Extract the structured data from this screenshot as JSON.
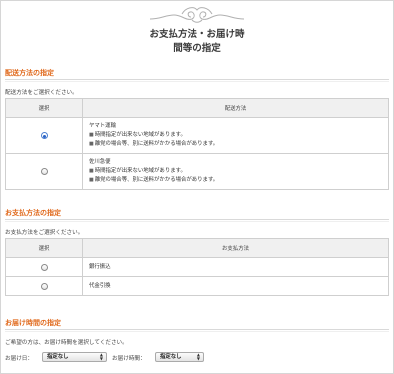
{
  "header": {
    "title_line1": "お支払方法・お届け時",
    "title_line2": "間等の指定"
  },
  "shipping": {
    "section_title": "配送方法の指定",
    "instruction": "配送方法をご選択ください。",
    "col_select": "選択",
    "col_method": "配送方法",
    "options": [
      {
        "name": "ヤマト運輸",
        "checked": true,
        "notes": [
          "時間指定が出来ない地域があります。",
          "離党の場合等、別に送料がかかる場合があります。"
        ]
      },
      {
        "name": "佐川急便",
        "checked": false,
        "notes": [
          "時間指定が出来ない地域があります。",
          "離党の場合等、別に送料がかかる場合があります。"
        ]
      }
    ]
  },
  "payment": {
    "section_title": "お支払方法の指定",
    "instruction": "お支払方法をご選択ください。",
    "col_select": "選択",
    "col_method": "お支払方法",
    "options": [
      {
        "name": "銀行振込",
        "checked": false
      },
      {
        "name": "代金引換",
        "checked": false
      }
    ]
  },
  "delivery_time": {
    "section_title": "お届け時間の指定",
    "instruction": "ご希望の方は、お届け時間を選択してください。",
    "date_label": "お届け日：",
    "date_value": "指定なし",
    "time_label": "お届け時間：",
    "time_value": "指定なし"
  }
}
